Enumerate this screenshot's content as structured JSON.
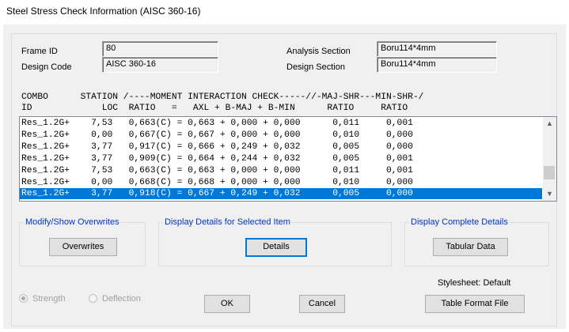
{
  "window": {
    "title": "Steel Stress Check Information (AISC 360-16)"
  },
  "info": {
    "frame_id_label": "Frame ID",
    "frame_id_value": "80",
    "design_code_label": "Design Code",
    "design_code_value": "AISC 360-16",
    "analysis_section_label": "Analysis Section",
    "analysis_section_value": "Boru114*4mm",
    "design_section_label": "Design Section",
    "design_section_value": "Boru114*4mm"
  },
  "table": {
    "header_line1": "COMBO      STATION /----MOMENT INTERACTION CHECK-----//-MAJ-SHR---MIN-SHR-/",
    "header_line2": "ID             LOC  RATIO   =   AXL + B-MAJ + B-MIN      RATIO     RATIO",
    "rows": [
      "Res_1.2G+    7,53   0,663(C) = 0,663 + 0,000 + 0,000      0,011     0,001",
      "Res_1.2G+    0,00   0,667(C) = 0,667 + 0,000 + 0,000      0,010     0,000",
      "Res_1.2G+    3,77   0,917(C) = 0,666 + 0,249 + 0,032      0,005     0,000",
      "Res_1.2G+    3,77   0,909(C) = 0,664 + 0,244 + 0,032      0,005     0,001",
      "Res_1.2G+    7,53   0,663(C) = 0,663 + 0,000 + 0,000      0,011     0,001",
      "Res_1.2G+    0,00   0,668(C) = 0,668 + 0,000 + 0,000      0,010     0,000",
      "Res_1.2G+    3,77   0,918(C) = 0,667 + 0,249 + 0,032      0,005     0,000"
    ],
    "selected_row_index": 6
  },
  "groups": {
    "modify_title": "Modify/Show Overwrites",
    "overwrites_button": "Overwrites",
    "details_title": "Display Details for Selected Item",
    "details_button": "Details",
    "complete_title": "Display Complete Details",
    "tabular_button": "Tabular Data"
  },
  "footer": {
    "stylesheet_label": "Stylesheet: Default",
    "strength_radio": "Strength",
    "deflection_radio": "Deflection",
    "ok_button": "OK",
    "cancel_button": "Cancel",
    "table_format_button": "Table Format File"
  },
  "colors": {
    "selection": "#0078d7",
    "group_title": "#0033cc",
    "dialog_bg": "#f0f0f0"
  }
}
